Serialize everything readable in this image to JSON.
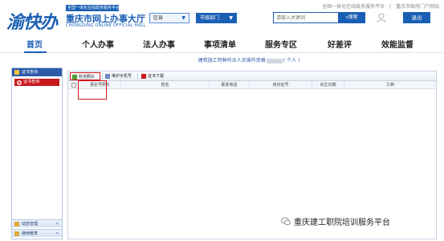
{
  "header": {
    "top_links": [
      "全国一体化在线政务服务平台",
      "重庆市政府门户网站"
    ],
    "logo_script": "渝快办",
    "logo_tagline": "全国一体化在线政务服务平台",
    "site_title": "重庆市网上办事大厅",
    "site_subtitle": "CHONGQING ONLINE OFFICIAL HALL",
    "region_select": "区县",
    "dept_select": "市级部门",
    "search_placeholder": "请输入关键词",
    "search_label": "搜索",
    "logout_label": "退出"
  },
  "nav": {
    "items": [
      "首页",
      "个人办事",
      "法人办事",
      "事项清单",
      "服务专区",
      "好差评",
      "效能监督"
    ]
  },
  "sidebar": {
    "header": "证书查询",
    "items": [
      "证书查询"
    ],
    "footer": [
      "动态管理",
      "继续教育"
    ]
  },
  "main": {
    "title": "建筑施工特种作业人员操作资格",
    "title_suffix": "( 个人 )",
    "toolbar": [
      "补交照片",
      "维护手机号",
      "证书下载"
    ],
    "columns": [
      "报名号照片",
      "姓名",
      "联系电话",
      "身份证号",
      "出生日期",
      "工种"
    ]
  },
  "watermark": "重庆建工职院培训服务平台",
  "colors": {
    "brand_blue": "#1a5fb4",
    "sidebar_header": "#2b5aa8",
    "active_item_red": "#c7191d",
    "annotation_red": "#d0191c"
  }
}
